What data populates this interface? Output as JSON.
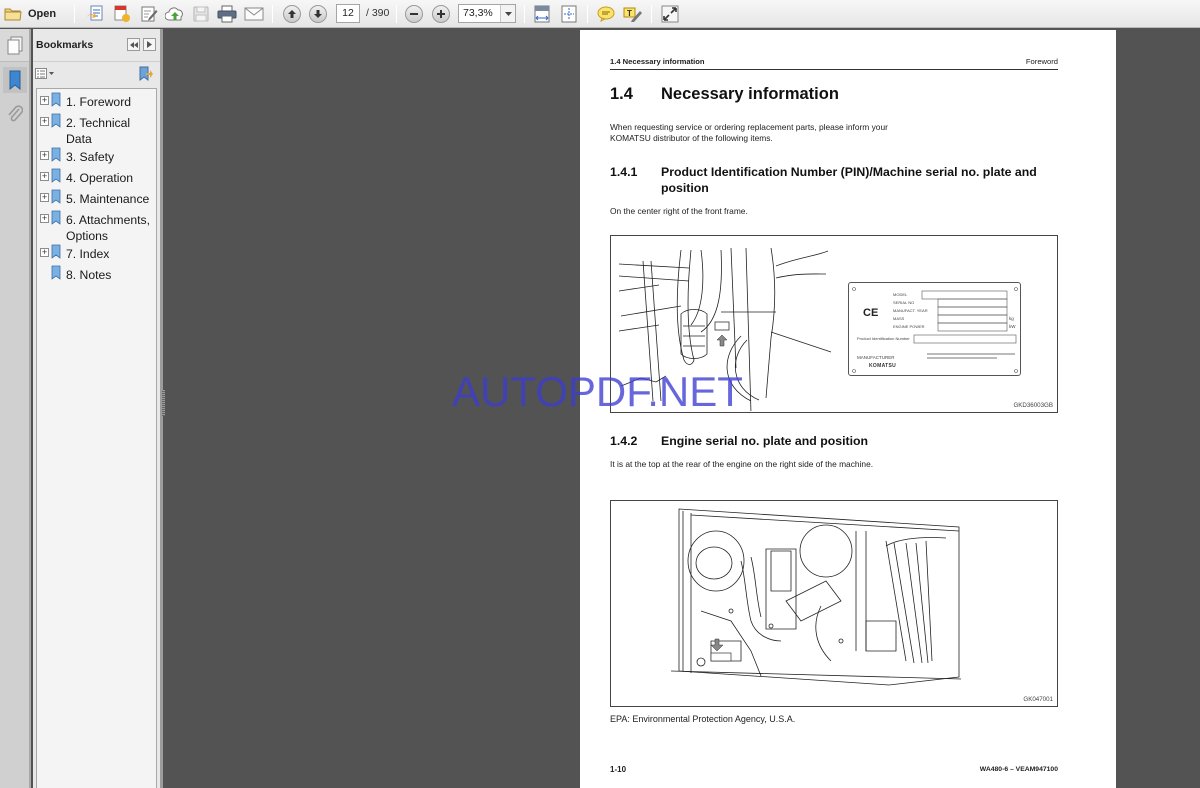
{
  "toolbar": {
    "open_label": "Open",
    "current_page": "12",
    "total_pages": "/ 390",
    "zoom_level": "73,3%",
    "icons": [
      "open-folder-icon",
      "create-pdf-icon",
      "combine-files-icon",
      "edit-pdf-icon",
      "cloud-upload-icon",
      "save-icon",
      "print-icon",
      "email-icon",
      "previous-page-icon",
      "next-page-icon",
      "zoom-out-icon",
      "zoom-in-icon",
      "zoom-dropdown-icon",
      "fit-width-icon",
      "fit-page-icon",
      "comment-icon",
      "highlight-text-icon",
      "full-screen-icon"
    ]
  },
  "navstrip": {
    "icons": [
      "page-thumbnails-icon",
      "bookmarks-icon",
      "attachments-icon"
    ]
  },
  "bookmarks": {
    "title": "Bookmarks",
    "items": [
      {
        "label": "1. Foreword",
        "expandable": true
      },
      {
        "label": "2. Technical Data",
        "expandable": true
      },
      {
        "label": "3. Safety",
        "expandable": true
      },
      {
        "label": "4. Operation",
        "expandable": true
      },
      {
        "label": "5. Maintenance",
        "expandable": true
      },
      {
        "label": "6. Attachments, Options",
        "expandable": true
      },
      {
        "label": "7. Index",
        "expandable": true
      },
      {
        "label": "8. Notes",
        "expandable": false
      }
    ]
  },
  "document": {
    "running_header_left": "1.4  Necessary information",
    "running_header_right": "Foreword",
    "section": {
      "number": "1.4",
      "title": "Necessary information"
    },
    "intro": "When requesting service or ordering replacement parts, please inform your KOMATSU distributor of the following items.",
    "sub1": {
      "number": "1.4.1",
      "title": "Product Identification Number (PIN)/Machine serial no. plate and position"
    },
    "sub1_text": "On the center right of the front frame.",
    "fig1_code": "GKD36003GB",
    "plate": {
      "ce_mark": "CE",
      "fields": [
        "MODEL",
        "SERIAL NO",
        "MANUFACT. YEAR",
        "MASS",
        "ENGINE POWER"
      ],
      "units": [
        "kg",
        "kW"
      ],
      "pin_label": "Product Identification Number",
      "manufacturer_label": "MANUFACTURER",
      "brand": "KOMATSU"
    },
    "sub2": {
      "number": "1.4.2",
      "title": "Engine serial no. plate and position"
    },
    "sub2_text": "It is at the top at the rear of the engine on the right side of the machine.",
    "fig2_code": "GK047001",
    "epa_note": "EPA: Environmental Protection Agency, U.S.A.",
    "footer_left": "1-10",
    "footer_right": "WA480-6 – VEAM947100"
  },
  "watermark": "AUTOPDF.NET",
  "colors": {
    "workspace": "#535353",
    "watermark": "#3c3cd2",
    "panel": "#e8e8e8"
  }
}
